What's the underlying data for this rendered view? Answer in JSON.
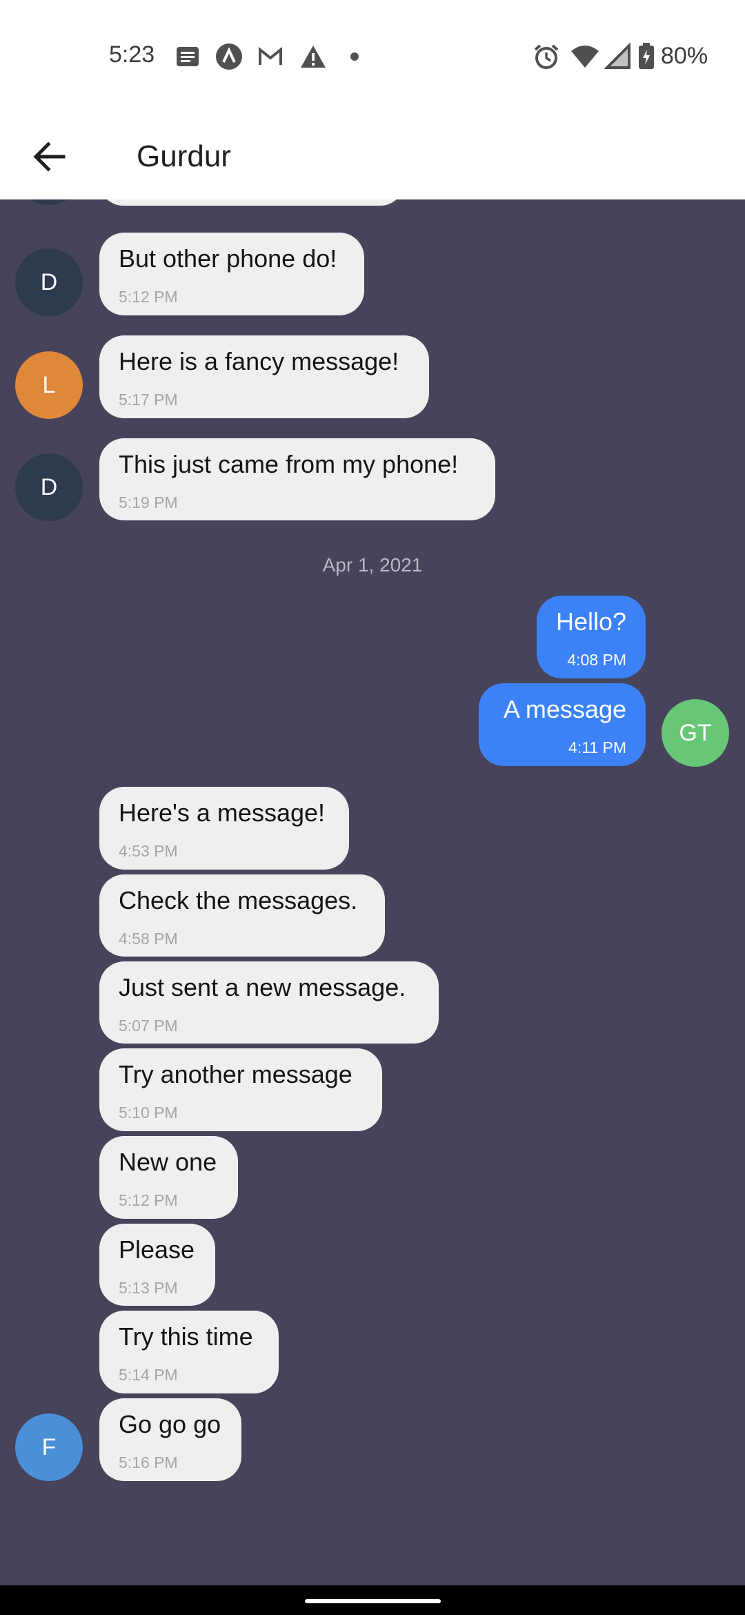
{
  "status_bar": {
    "time": "5:23",
    "battery": "80%",
    "icons": [
      "notes-icon",
      "app-a-icon",
      "gmail-icon",
      "warning-icon",
      "dot-icon",
      "alarm-icon",
      "wifi-icon",
      "signal-icon",
      "battery-icon"
    ]
  },
  "app_bar": {
    "title": "Gurdur",
    "back_icon": "arrow-left-icon"
  },
  "colors": {
    "chat_background": "#46435a",
    "incoming_bubble": "#efefef",
    "outgoing_bubble": "#3c82f6",
    "avatar_D": "#2e3a4e",
    "avatar_L": "#e0883a",
    "avatar_GT": "#68c777",
    "avatar_F": "#4a90d9"
  },
  "messages": {
    "m1": {
      "text": "But other phone do!",
      "time": "5:12 PM",
      "avatar": "D"
    },
    "m2": {
      "text": "Here is a fancy message!",
      "time": "5:17 PM",
      "avatar": "L"
    },
    "m3": {
      "text": "This just came from my phone!",
      "time": "5:19 PM",
      "avatar": "D"
    },
    "date_separator": "Apr 1, 2021",
    "m4": {
      "text": "Hello?",
      "time": "4:08 PM"
    },
    "m5": {
      "text": "A message",
      "time": "4:11 PM",
      "avatar": "GT"
    },
    "m6": {
      "text": "Here's a message!",
      "time": "4:53 PM"
    },
    "m7": {
      "text": "Check the messages.",
      "time": "4:58 PM"
    },
    "m8": {
      "text": "Just sent a new message.",
      "time": "5:07 PM"
    },
    "m9": {
      "text": "Try another message",
      "time": "5:10 PM"
    },
    "m10": {
      "text": "New one",
      "time": "5:12 PM"
    },
    "m11": {
      "text": "Please",
      "time": "5:13 PM"
    },
    "m12": {
      "text": "Try this time",
      "time": "5:14 PM"
    },
    "m13": {
      "text": "Go go go",
      "time": "5:16 PM",
      "avatar": "F"
    }
  }
}
